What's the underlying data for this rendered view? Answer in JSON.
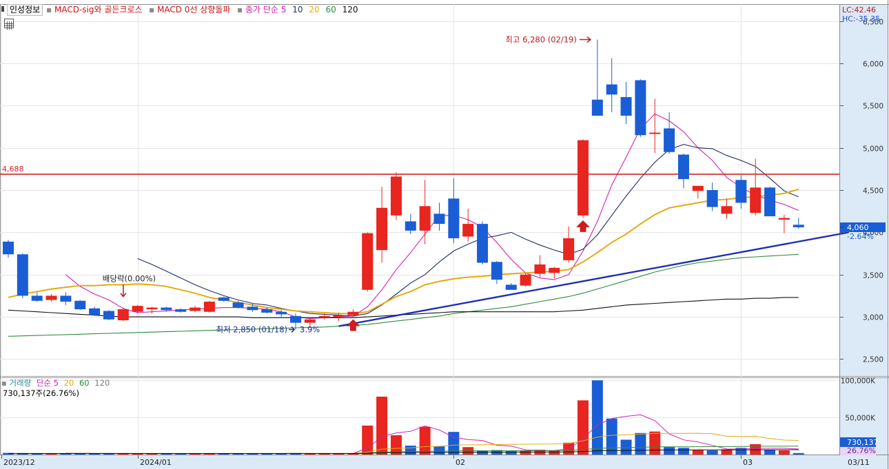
{
  "toolbar": {
    "tab_label": "인성정보",
    "indicator1": "MACD-sig와 골든크로스",
    "indicator2": "MACD 0선 상향돌파",
    "ma_label": "종가 단순 5",
    "ma_periods": [
      "10",
      "20",
      "60",
      "120"
    ]
  },
  "readouts": {
    "lc": "LC:42.46",
    "hc": "HC:-35.35"
  },
  "colors": {
    "up": "#e8251f",
    "down": "#1a5ed6",
    "ma5": "#d21fb5",
    "ma10": "#1c2c63",
    "ma20": "#e5aa10",
    "ma60": "#2e8b3c",
    "ma120": "#101010",
    "hline": "#d42020",
    "trend": "#1f2fb0"
  },
  "chart_data": [
    {
      "type": "candlestick",
      "y_ticks": [
        "6,500",
        "6,000",
        "5,500",
        "5,000",
        "4,500",
        "4,000",
        "3,500",
        "3,000",
        "2,500"
      ],
      "ylim": [
        2300,
        6700
      ],
      "x_ticks": [
        "2023/12",
        "2024/01",
        "02",
        "03",
        "03/11"
      ],
      "candles": [
        {
          "o": 3890,
          "h": 3910,
          "l": 3700,
          "c": 3740
        },
        {
          "o": 3740,
          "h": 3750,
          "l": 3220,
          "c": 3250
        },
        {
          "o": 3250,
          "h": 3290,
          "l": 3180,
          "c": 3190
        },
        {
          "o": 3200,
          "h": 3270,
          "l": 3180,
          "c": 3250
        },
        {
          "o": 3250,
          "h": 3290,
          "l": 3140,
          "c": 3180
        },
        {
          "o": 3190,
          "h": 3200,
          "l": 3080,
          "c": 3090
        },
        {
          "o": 3100,
          "h": 3120,
          "l": 3010,
          "c": 3020
        },
        {
          "o": 3070,
          "h": 3080,
          "l": 2960,
          "c": 2970
        },
        {
          "o": 2960,
          "h": 3110,
          "l": 2950,
          "c": 3090
        },
        {
          "o": 3060,
          "h": 3140,
          "l": 3040,
          "c": 3130
        },
        {
          "o": 3090,
          "h": 3120,
          "l": 3040,
          "c": 3110
        },
        {
          "o": 3110,
          "h": 3120,
          "l": 3060,
          "c": 3080
        },
        {
          "o": 3090,
          "h": 3100,
          "l": 3050,
          "c": 3060
        },
        {
          "o": 3070,
          "h": 3130,
          "l": 3060,
          "c": 3110
        },
        {
          "o": 3060,
          "h": 3190,
          "l": 3050,
          "c": 3180
        },
        {
          "o": 3230,
          "h": 3240,
          "l": 3180,
          "c": 3190
        },
        {
          "o": 3170,
          "h": 3190,
          "l": 3100,
          "c": 3110
        },
        {
          "o": 3120,
          "h": 3160,
          "l": 3060,
          "c": 3080
        },
        {
          "o": 3090,
          "h": 3110,
          "l": 3040,
          "c": 3050
        },
        {
          "o": 3060,
          "h": 3080,
          "l": 3000,
          "c": 3030
        },
        {
          "o": 3010,
          "h": 3040,
          "l": 2850,
          "c": 2930
        },
        {
          "o": 2930,
          "h": 2990,
          "l": 2880,
          "c": 2970
        },
        {
          "o": 2990,
          "h": 3040,
          "l": 2970,
          "c": 3010
        },
        {
          "o": 3000,
          "h": 3050,
          "l": 2950,
          "c": 3020
        },
        {
          "o": 3020,
          "h": 3090,
          "l": 3000,
          "c": 3060
        },
        {
          "o": 3320,
          "h": 4000,
          "l": 3300,
          "c": 3990
        },
        {
          "o": 3790,
          "h": 4540,
          "l": 3640,
          "c": 4290
        },
        {
          "o": 4200,
          "h": 4710,
          "l": 4150,
          "c": 4660
        },
        {
          "o": 4130,
          "h": 4220,
          "l": 3980,
          "c": 4020
        },
        {
          "o": 4020,
          "h": 4620,
          "l": 3860,
          "c": 4310
        },
        {
          "o": 4220,
          "h": 4350,
          "l": 4020,
          "c": 4100
        },
        {
          "o": 4400,
          "h": 4640,
          "l": 3870,
          "c": 3930
        },
        {
          "o": 3950,
          "h": 4280,
          "l": 3890,
          "c": 4100
        },
        {
          "o": 4100,
          "h": 4130,
          "l": 3620,
          "c": 3640
        },
        {
          "o": 3650,
          "h": 3660,
          "l": 3390,
          "c": 3440
        },
        {
          "o": 3380,
          "h": 3400,
          "l": 3320,
          "c": 3320
        },
        {
          "o": 3370,
          "h": 3520,
          "l": 3360,
          "c": 3500
        },
        {
          "o": 3510,
          "h": 3730,
          "l": 3470,
          "c": 3620
        },
        {
          "o": 3520,
          "h": 3590,
          "l": 3450,
          "c": 3580
        },
        {
          "o": 3670,
          "h": 4070,
          "l": 3640,
          "c": 3930
        },
        {
          "o": 4200,
          "h": 5100,
          "l": 4170,
          "c": 5090
        },
        {
          "o": 5570,
          "h": 6280,
          "l": 5380,
          "c": 5380
        },
        {
          "o": 5750,
          "h": 6060,
          "l": 5420,
          "c": 5630
        },
        {
          "o": 5600,
          "h": 5780,
          "l": 5280,
          "c": 5380
        },
        {
          "o": 5800,
          "h": 5810,
          "l": 5130,
          "c": 5150
        },
        {
          "o": 5180,
          "h": 5580,
          "l": 4940,
          "c": 5180
        },
        {
          "o": 5230,
          "h": 5420,
          "l": 4930,
          "c": 4950
        },
        {
          "o": 4920,
          "h": 4930,
          "l": 4520,
          "c": 4630
        },
        {
          "o": 4490,
          "h": 4550,
          "l": 4400,
          "c": 4550
        },
        {
          "o": 4500,
          "h": 4590,
          "l": 4250,
          "c": 4300
        },
        {
          "o": 4220,
          "h": 4400,
          "l": 4160,
          "c": 4310
        },
        {
          "o": 4620,
          "h": 4680,
          "l": 4280,
          "c": 4350
        },
        {
          "o": 4230,
          "h": 4870,
          "l": 4200,
          "c": 4530
        },
        {
          "o": 4530,
          "h": 4540,
          "l": 4190,
          "c": 4190
        },
        {
          "o": 4150,
          "h": 4210,
          "l": 3990,
          "c": 4170
        },
        {
          "o": 4090,
          "h": 4170,
          "l": 4040,
          "c": 4060
        }
      ],
      "moving_averages": [
        {
          "name": "5",
          "color": "#d21fb5",
          "values": [
            null,
            null,
            null,
            null,
            3500,
            3360,
            3270,
            3200,
            3100,
            3050,
            3060,
            3070,
            3080,
            3090,
            3100,
            3110,
            3110,
            3100,
            3090,
            3060,
            3000,
            2980,
            2990,
            3000,
            3010,
            3120,
            3320,
            3560,
            3760,
            3980,
            4200,
            4200,
            4150,
            4060,
            3880,
            3680,
            3520,
            3460,
            3440,
            3500,
            3780,
            4130,
            4560,
            4890,
            5230,
            5400,
            5320,
            5190,
            5000,
            4850,
            4650,
            4530,
            4440,
            4380,
            4330,
            4260
          ]
        },
        {
          "name": "10",
          "color": "#1c2c63",
          "values": [
            null,
            null,
            null,
            null,
            null,
            null,
            null,
            null,
            null,
            3690,
            3620,
            3540,
            3460,
            3380,
            3310,
            3250,
            3200,
            3160,
            3140,
            3100,
            3070,
            3040,
            3030,
            3020,
            3010,
            3040,
            3140,
            3270,
            3400,
            3500,
            3650,
            3780,
            3860,
            3930,
            3960,
            4000,
            3920,
            3850,
            3790,
            3740,
            3800,
            3970,
            4200,
            4430,
            4640,
            4830,
            4980,
            5040,
            5000,
            4990,
            4910,
            4850,
            4780,
            4640,
            4490,
            4420
          ]
        },
        {
          "name": "20",
          "color": "#e5aa10",
          "values": [
            3230,
            3270,
            3300,
            3330,
            3350,
            3370,
            3370,
            3380,
            3380,
            3390,
            3380,
            3360,
            3320,
            3280,
            3230,
            3200,
            3170,
            3140,
            3110,
            3090,
            3070,
            3060,
            3050,
            3040,
            3040,
            3060,
            3150,
            3240,
            3300,
            3380,
            3420,
            3450,
            3470,
            3480,
            3500,
            3510,
            3520,
            3530,
            3540,
            3560,
            3650,
            3760,
            3880,
            3980,
            4100,
            4210,
            4290,
            4320,
            4350,
            4380,
            4390,
            4410,
            4420,
            4440,
            4460,
            4510
          ]
        },
        {
          "name": "60",
          "color": "#2e8b3c",
          "values": [
            2770,
            2775,
            2780,
            2785,
            2790,
            2795,
            2800,
            2805,
            2810,
            2815,
            2820,
            2825,
            2830,
            2835,
            2840,
            2845,
            2850,
            2855,
            2860,
            2865,
            2870,
            2875,
            2880,
            2890,
            2900,
            2910,
            2930,
            2950,
            2970,
            2990,
            3010,
            3040,
            3060,
            3080,
            3100,
            3120,
            3150,
            3180,
            3210,
            3240,
            3280,
            3330,
            3380,
            3430,
            3480,
            3530,
            3570,
            3610,
            3640,
            3660,
            3680,
            3700,
            3710,
            3720,
            3730,
            3740
          ]
        },
        {
          "name": "120",
          "color": "#101010",
          "values": [
            3080,
            3070,
            3060,
            3050,
            3040,
            3030,
            3020,
            3010,
            3000,
            3000,
            3000,
            3000,
            3000,
            3000,
            3000,
            3000,
            3000,
            2990,
            2990,
            2990,
            2990,
            2990,
            2990,
            2990,
            2990,
            3000,
            3010,
            3020,
            3030,
            3040,
            3050,
            3060,
            3060,
            3060,
            3060,
            3060,
            3060,
            3060,
            3060,
            3070,
            3080,
            3100,
            3120,
            3140,
            3150,
            3160,
            3170,
            3180,
            3190,
            3200,
            3210,
            3210,
            3220,
            3220,
            3230,
            3230
          ]
        }
      ],
      "horizontal_line": {
        "value": 4688,
        "label": "4,688"
      },
      "trendline": {
        "from_index": 23,
        "from_value": 2890,
        "to_index": 58.5,
        "to_value": 4000
      },
      "annotations": {
        "high": "최고 6,280 (02/19)",
        "low": "최저 2,850 (01/18)",
        "low_pct": "3.9%",
        "dividend": "배당락(0.00%)"
      },
      "signal_arrows": [
        24,
        40
      ],
      "dividend_index": 8,
      "last_price": "4,060",
      "last_change": "-2.64%"
    },
    {
      "type": "bar",
      "title": "거래량",
      "ma_label": "단순 5",
      "ma_periods": [
        "20",
        "60",
        "120"
      ],
      "current_volume": "730,137주(26.76%)",
      "y_ticks": [
        "100,000K",
        "50,000K"
      ],
      "ylim": [
        0,
        103000
      ],
      "last_volume": "730,137",
      "last_volume_pct": "26.76%",
      "values_k": [
        2200,
        2000,
        1700,
        1500,
        1600,
        1400,
        1400,
        1400,
        1500,
        1400,
        1300,
        1300,
        1200,
        1300,
        1500,
        1400,
        1400,
        1300,
        1300,
        1200,
        2000,
        1300,
        1200,
        1200,
        1500,
        39000,
        78000,
        26000,
        12000,
        37500,
        11000,
        30500,
        10000,
        5500,
        6000,
        4500,
        5500,
        6500,
        5000,
        16000,
        73000,
        100000,
        48500,
        20000,
        29000,
        31000,
        10000,
        9000,
        6000,
        5500,
        7000,
        9000,
        14000,
        6500,
        5500,
        2000
      ],
      "ma_lines": [
        {
          "name": "5",
          "color": "#d21fb5",
          "values_k": [
            null,
            null,
            null,
            null,
            1800,
            1640,
            1520,
            1460,
            1460,
            1420,
            1400,
            1380,
            1340,
            1320,
            1340,
            1340,
            1360,
            1380,
            1380,
            1320,
            1440,
            1400,
            1400,
            1400,
            1440,
            8840,
            24160,
            29140,
            31300,
            38500,
            33000,
            23400,
            20200,
            18900,
            12600,
            11400,
            6300,
            5600,
            5500,
            7700,
            21000,
            40100,
            48500,
            51500,
            53500,
            45700,
            27700,
            19800,
            17000,
            12300,
            7500,
            7300,
            8300,
            8400,
            8400,
            7400
          ]
        },
        {
          "name": "20",
          "color": "#e5aa10",
          "values_k": [
            null,
            null,
            null,
            null,
            null,
            null,
            null,
            null,
            null,
            null,
            null,
            null,
            null,
            null,
            null,
            null,
            null,
            null,
            null,
            1500,
            1500,
            1480,
            1460,
            1450,
            1450,
            3330,
            7150,
            8390,
            8890,
            10690,
            11170,
            12640,
            13070,
            13280,
            13530,
            13680,
            13880,
            14110,
            14290,
            15000,
            18500,
            23500,
            26000,
            26500,
            27500,
            28700,
            28600,
            28500,
            28700,
            28100,
            24700,
            24300,
            24700,
            21600,
            19500,
            19000
          ]
        },
        {
          "name": "60",
          "color": "#2e8b3c",
          "values_k": [
            1500,
            1500,
            1500,
            1500,
            1500,
            1500,
            1500,
            1500,
            1500,
            1500,
            1500,
            1500,
            1500,
            1500,
            1500,
            1500,
            1500,
            1500,
            1500,
            1500,
            1500,
            1500,
            1500,
            1500,
            1500,
            2100,
            3400,
            3800,
            3900,
            4400,
            4500,
            4900,
            5000,
            5000,
            5100,
            5100,
            5200,
            5200,
            5300,
            5500,
            6700,
            8300,
            9000,
            9300,
            9800,
            10300,
            10400,
            10500,
            10600,
            10700,
            10800,
            10900,
            11100,
            11200,
            11200,
            11200
          ]
        },
        {
          "name": "120",
          "color": "#101010",
          "values_k": [
            1400,
            1400,
            1400,
            1400,
            1400,
            1400,
            1400,
            1400,
            1400,
            1400,
            1400,
            1400,
            1400,
            1400,
            1400,
            1400,
            1400,
            1400,
            1400,
            1400,
            1400,
            1400,
            1400,
            1400,
            1400,
            1700,
            2300,
            2500,
            2600,
            2900,
            2900,
            3100,
            3200,
            3200,
            3200,
            3300,
            3300,
            3300,
            3400,
            3500,
            4100,
            5000,
            5300,
            5500,
            5700,
            6000,
            6100,
            6100,
            6200,
            6200,
            6300,
            6300,
            6400,
            6400,
            6500,
            6500
          ]
        }
      ]
    }
  ]
}
